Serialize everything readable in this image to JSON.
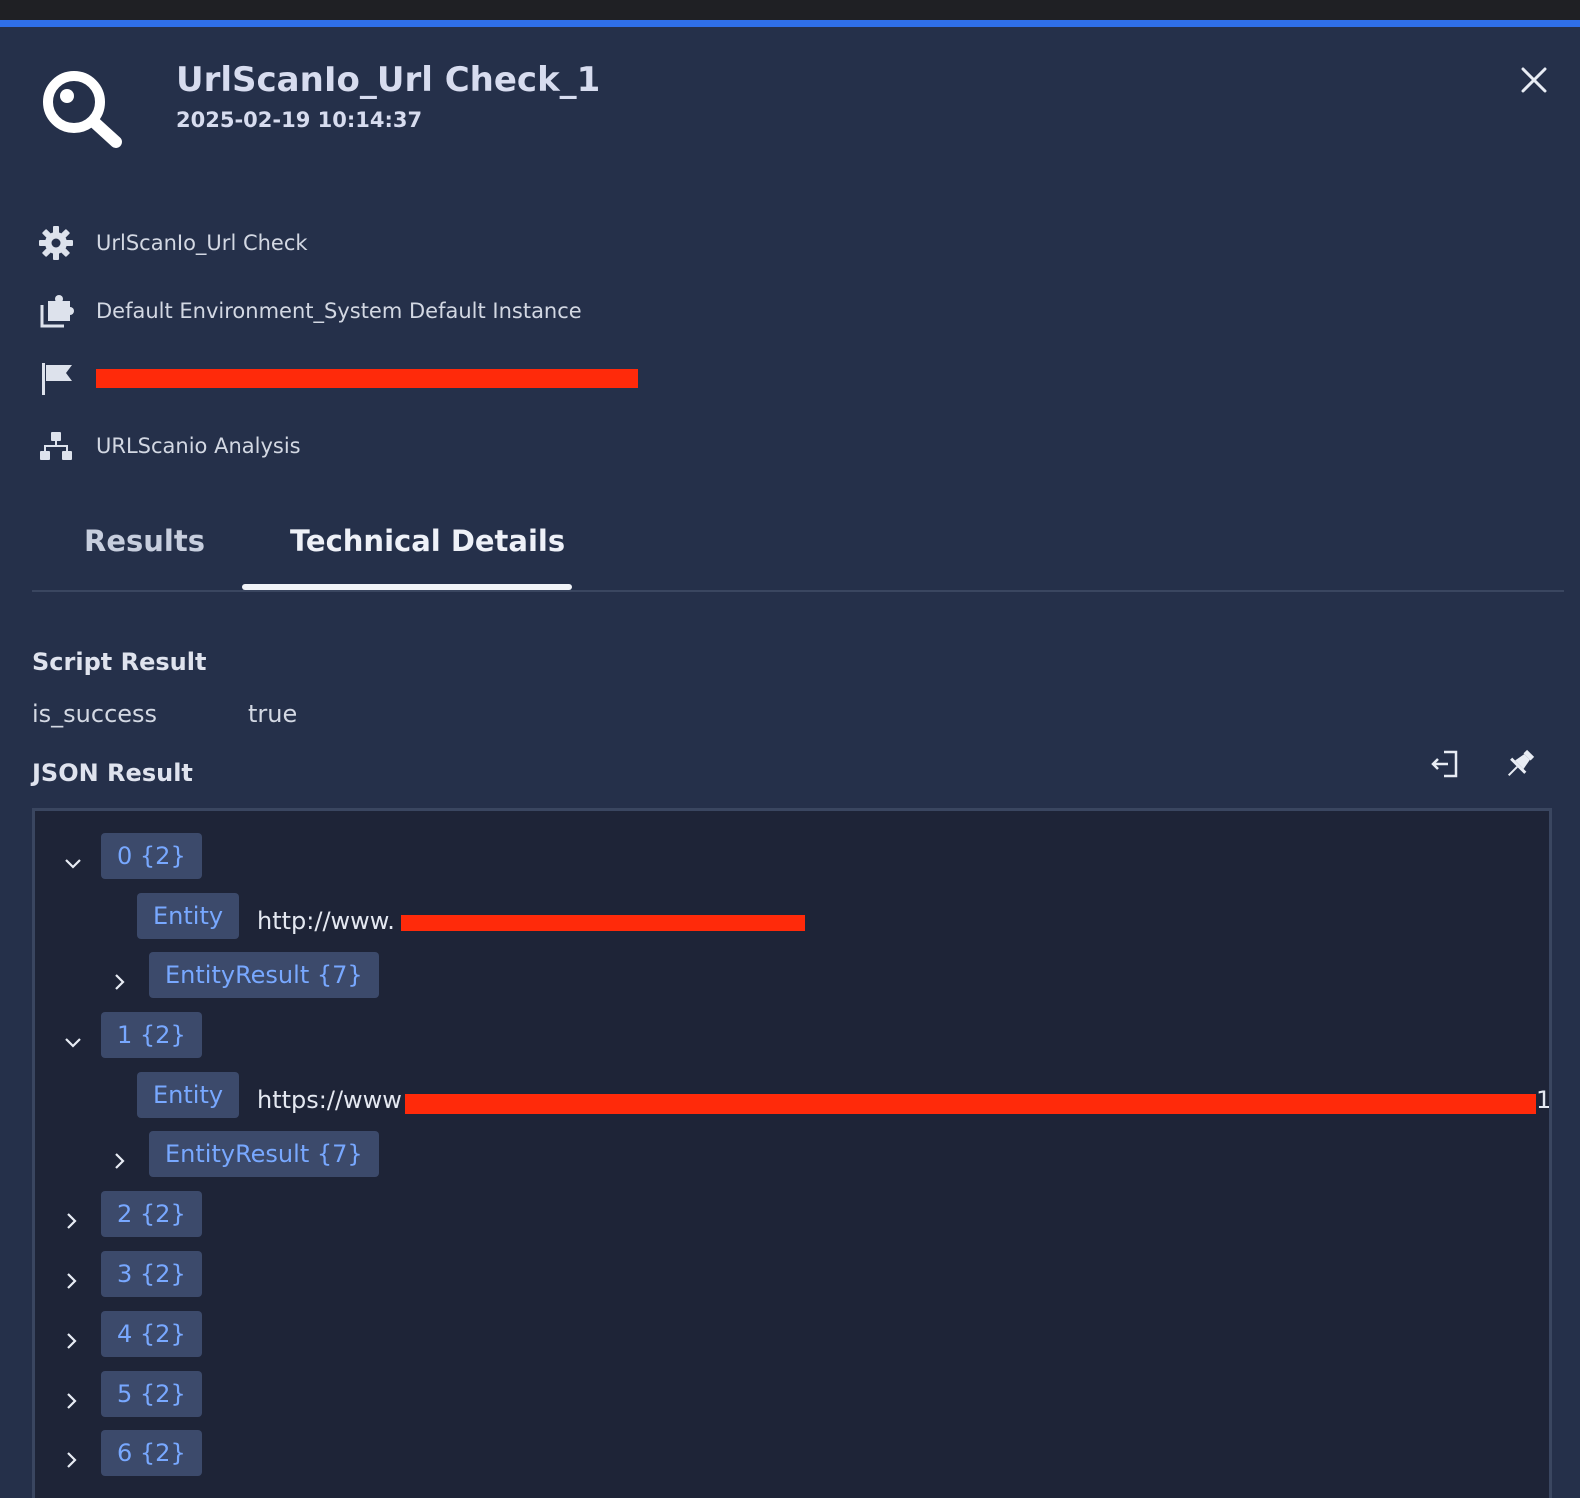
{
  "header": {
    "title": "UrlScanIo_Url Check_1",
    "timestamp": "2025-02-19 10:14:37"
  },
  "meta": {
    "integration": "UrlScanIo_Url Check",
    "environment": "Default Environment_System Default Instance",
    "playbook": "URLScanio Analysis"
  },
  "tabs": [
    {
      "label": "Results"
    },
    {
      "label": "Technical Details"
    }
  ],
  "script_result": {
    "heading": "Script Result",
    "key": "is_success",
    "value": "true"
  },
  "json_result": {
    "heading": "JSON Result",
    "nodes": [
      {
        "label": "0 {2}",
        "entity_key": "Entity",
        "entity_value": "http://www.",
        "result_label": "EntityResult {7}"
      },
      {
        "label": "1 {2}",
        "entity_key": "Entity",
        "entity_value": "https://www",
        "result_label": "EntityResult {7}",
        "tail": "1"
      },
      {
        "label": "2 {2}"
      },
      {
        "label": "3 {2}"
      },
      {
        "label": "4 {2}"
      },
      {
        "label": "5 {2}"
      },
      {
        "label": "6 {2}"
      }
    ]
  },
  "colors": {
    "accent": "#2f6fe8",
    "panel": "#25304a",
    "pill": "#3c4a6b",
    "pill_text": "#78a8ff",
    "redaction": "#ff2a0a"
  }
}
